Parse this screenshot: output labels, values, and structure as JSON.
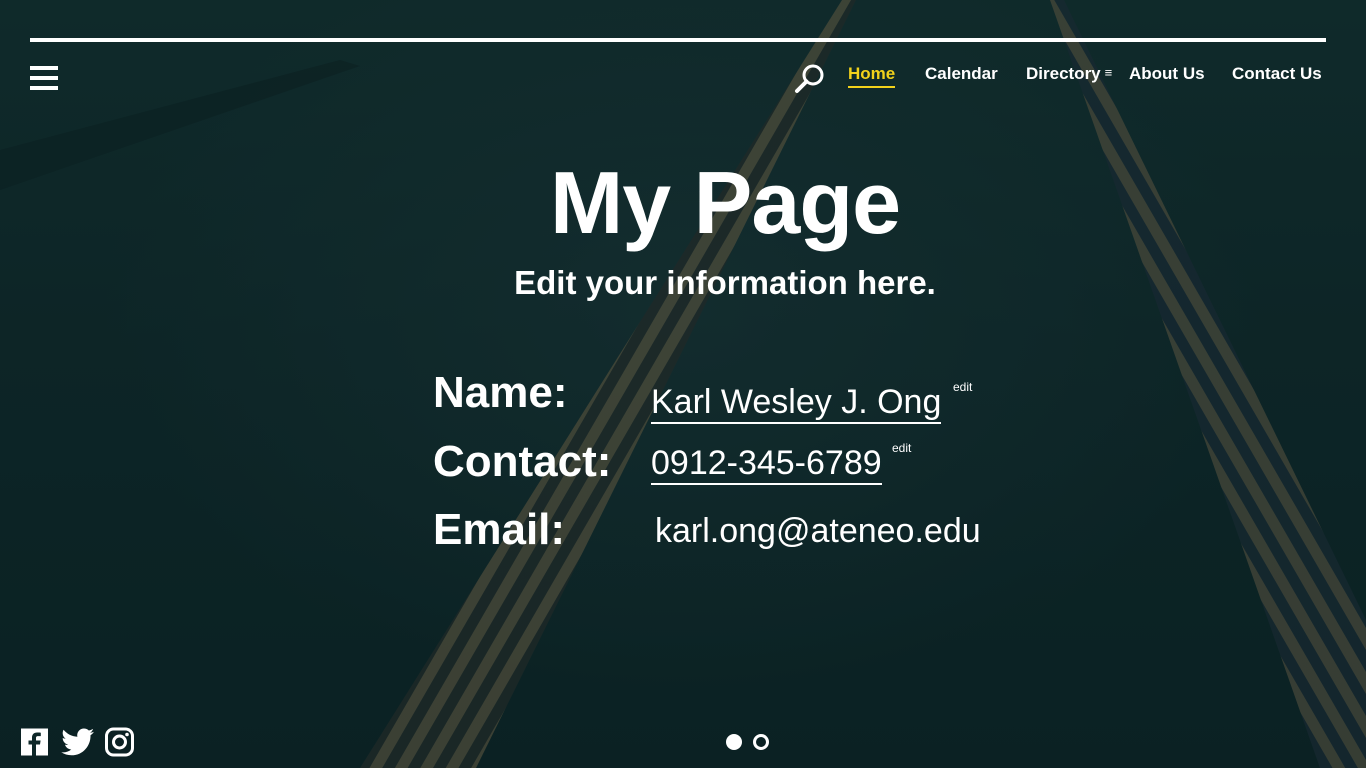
{
  "header": {
    "menu_icon": "hamburger-menu-icon",
    "search_icon": "magnifier-search-icon",
    "nav": [
      {
        "label": "Home",
        "active": true
      },
      {
        "label": "Calendar",
        "active": false
      },
      {
        "label": "Directory",
        "active": false,
        "submenu_glyph": "≡"
      },
      {
        "label": "About Us",
        "active": false
      },
      {
        "label": "Contact Us",
        "active": false
      }
    ],
    "active_color": "#f2d21b"
  },
  "main": {
    "title": "My Page",
    "subtitle": "Edit your information here.",
    "fields": [
      {
        "label": "Name:",
        "value": "Karl Wesley J. Ong",
        "edit_label": "edit",
        "editable": true
      },
      {
        "label": "Contact:",
        "value": "0912-345-6789",
        "edit_label": "edit",
        "editable": true
      },
      {
        "label": "Email:",
        "value": "karl.ong@ateneo.edu",
        "editable": false
      }
    ]
  },
  "footer": {
    "social": [
      "facebook-icon",
      "twitter-icon",
      "instagram-icon"
    ],
    "slides": {
      "count": 2,
      "active": 1
    }
  }
}
